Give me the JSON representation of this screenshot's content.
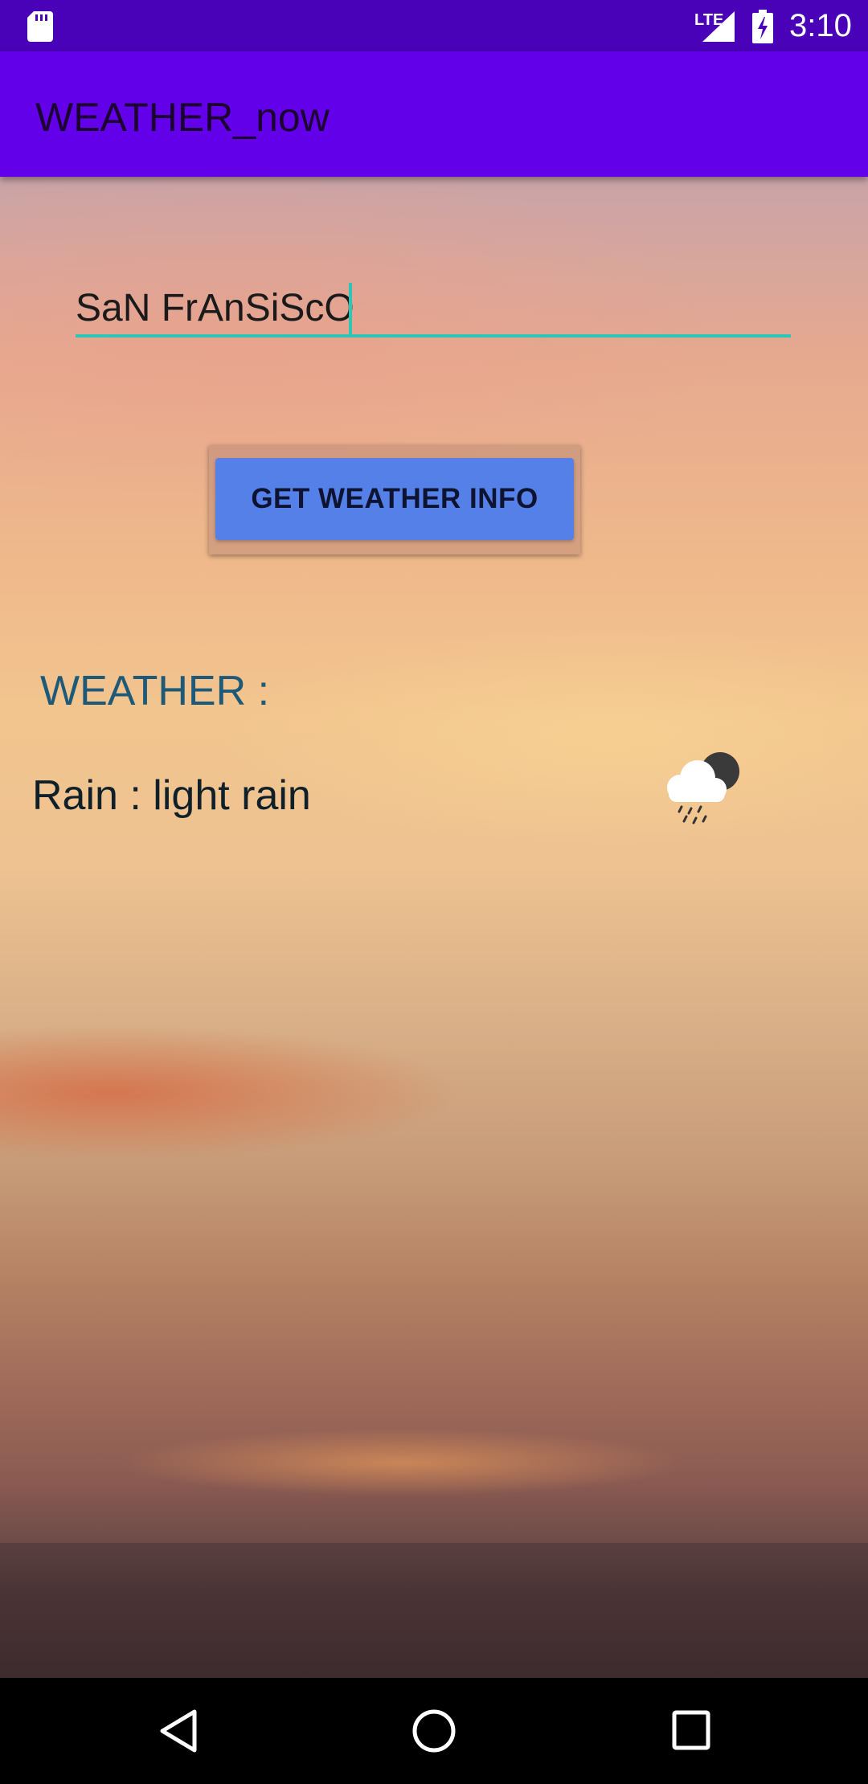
{
  "status_bar": {
    "time": "3:10",
    "network_label": "LTE",
    "icons": [
      "sd-card-icon",
      "signal-icon",
      "battery-charging-icon"
    ]
  },
  "app_bar": {
    "title": "WEATHER_now"
  },
  "search": {
    "city_value": "SaN FrAnSiScO"
  },
  "actions": {
    "get_weather_label": "GET WEATHER INFO"
  },
  "weather": {
    "heading": "WEATHER :",
    "description": "Rain : light rain",
    "icon": "rain-cloud-night-icon"
  },
  "colors": {
    "status_bar": "#4a02b9",
    "app_bar": "#6200ea",
    "input_underline": "#2ec4b6",
    "button": "#5580e8",
    "heading_text": "#1e5a78"
  },
  "nav_bar": {
    "icons": [
      "back-icon",
      "home-icon",
      "recents-icon"
    ]
  }
}
